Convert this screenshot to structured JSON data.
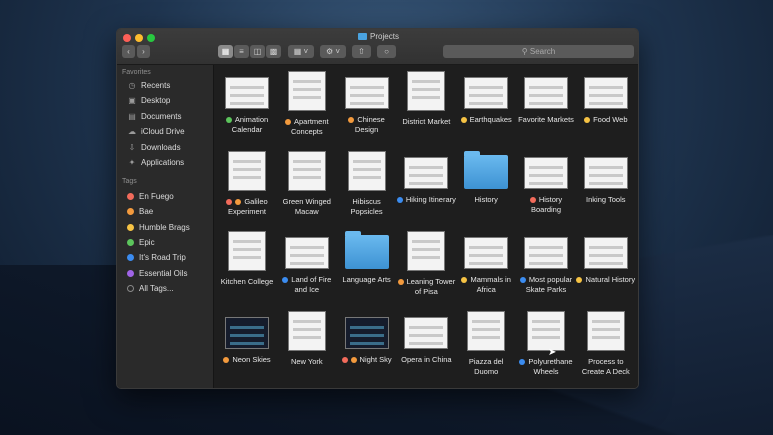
{
  "window": {
    "title": "Projects"
  },
  "toolbar": {
    "search_placeholder": "Search"
  },
  "sidebar": {
    "favorites_heading": "Favorites",
    "favorites": [
      {
        "label": "Recents",
        "icon": "clock-icon"
      },
      {
        "label": "Desktop",
        "icon": "desktop-icon"
      },
      {
        "label": "Documents",
        "icon": "documents-icon"
      },
      {
        "label": "iCloud Drive",
        "icon": "cloud-icon"
      },
      {
        "label": "Downloads",
        "icon": "download-icon"
      },
      {
        "label": "Applications",
        "icon": "applications-icon"
      }
    ],
    "tags_heading": "Tags",
    "tags": [
      {
        "label": "En Fuego",
        "color": "#f26b5b"
      },
      {
        "label": "Bae",
        "color": "#f39a3d"
      },
      {
        "label": "Humble Brags",
        "color": "#f6c344"
      },
      {
        "label": "Epic",
        "color": "#5cc55c"
      },
      {
        "label": "It's Road Trip",
        "color": "#3b8cf0"
      },
      {
        "label": "Essential Oils",
        "color": "#a064e6"
      },
      {
        "label": "All Tags...",
        "color": "#777777"
      }
    ]
  },
  "files": [
    {
      "name": "Animation Calendar",
      "tags": [
        "#5cc55c"
      ]
    },
    {
      "name": "Apartment Concepts",
      "tags": [
        "#f39a3d"
      ]
    },
    {
      "name": "Chinese Design",
      "tags": [
        "#f39a3d"
      ]
    },
    {
      "name": "District Market",
      "tags": []
    },
    {
      "name": "Earthquakes",
      "tags": [
        "#f6c344"
      ]
    },
    {
      "name": "Favorite Markets",
      "tags": []
    },
    {
      "name": "Food Web",
      "tags": [
        "#f6c344"
      ]
    },
    {
      "name": "Galileo Experiment",
      "tags": [
        "#f26b5b",
        "#f39a3d"
      ]
    },
    {
      "name": "Green Winged Macaw",
      "tags": []
    },
    {
      "name": "Hibiscus Popsicles",
      "tags": []
    },
    {
      "name": "Hiking Itinerary",
      "tags": [
        "#3b8cf0"
      ]
    },
    {
      "name": "History",
      "tags": []
    },
    {
      "name": "History Boarding",
      "tags": [
        "#f26b5b"
      ]
    },
    {
      "name": "Inking Tools",
      "tags": []
    },
    {
      "name": "Kitchen College",
      "tags": []
    },
    {
      "name": "Land of Fire and Ice",
      "tags": [
        "#3b8cf0"
      ]
    },
    {
      "name": "Language Arts",
      "tags": []
    },
    {
      "name": "Leaning Tower of Pisa",
      "tags": [
        "#f39a3d"
      ]
    },
    {
      "name": "Mammals in Africa",
      "tags": [
        "#f6c344"
      ]
    },
    {
      "name": "Most popular Skate Parks",
      "tags": [
        "#3b8cf0"
      ]
    },
    {
      "name": "Natural History",
      "tags": [
        "#f6c344"
      ]
    },
    {
      "name": "Neon Skies",
      "tags": [
        "#f39a3d"
      ]
    },
    {
      "name": "New York",
      "tags": []
    },
    {
      "name": "Night Sky",
      "tags": [
        "#f26b5b",
        "#f39a3d"
      ]
    },
    {
      "name": "Opera in China",
      "tags": []
    },
    {
      "name": "Piazza del Duomo",
      "tags": []
    },
    {
      "name": "Polyurethane Wheels",
      "tags": [
        "#3b8cf0"
      ]
    },
    {
      "name": "Process to Create A Deck",
      "tags": []
    }
  ]
}
